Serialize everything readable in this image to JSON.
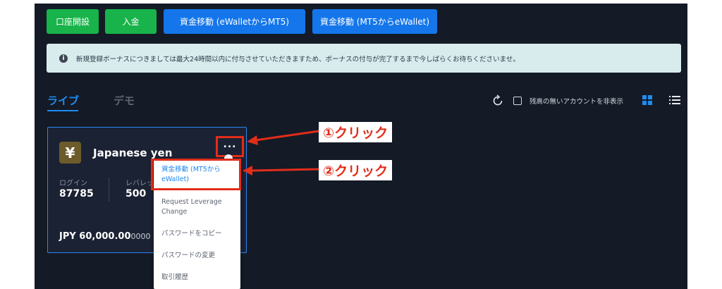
{
  "toolbar": {
    "open_account": "口座開設",
    "deposit": "入金",
    "transfer_to_mt5": "資金移動 (eWalletからMT5)",
    "transfer_to_ewallet": "資金移動 (MT5からeWallet)"
  },
  "notice": {
    "text": "新規登録ボーナスにつきましては最大24時間以内に付与させていただきますため、ボーナスの付与が完了するまで今しばらくお待ちくださいませ。"
  },
  "tabs": {
    "live": "ライブ",
    "demo": "デモ"
  },
  "filters": {
    "hide_zero_balance": "残高の無いアカウントを非表示"
  },
  "account": {
    "currency_symbol": "¥",
    "currency_name": "Japanese yen",
    "login_label": "ログイン",
    "login_value": "87785",
    "leverage_label": "レバレッ",
    "leverage_value": "500",
    "balance_main": "JPY 60,000.00",
    "balance_tail": "0000"
  },
  "menu": {
    "transfer_line1": "資金移動 (MT5から",
    "transfer_line2": "eWallet)",
    "leverage_line1": "Request Leverage",
    "leverage_line2": "Change",
    "copy_password": "パスワードをコピー",
    "change_password": "パスワードの変更",
    "history": "取引履歴"
  },
  "annotations": {
    "step1": "①クリック",
    "step2": "②クリック"
  },
  "colors": {
    "background": "#141a26",
    "green": "#18b34a",
    "blue": "#1476ea",
    "accent": "#1e8cf0",
    "annotation_red": "#e12d1a"
  }
}
